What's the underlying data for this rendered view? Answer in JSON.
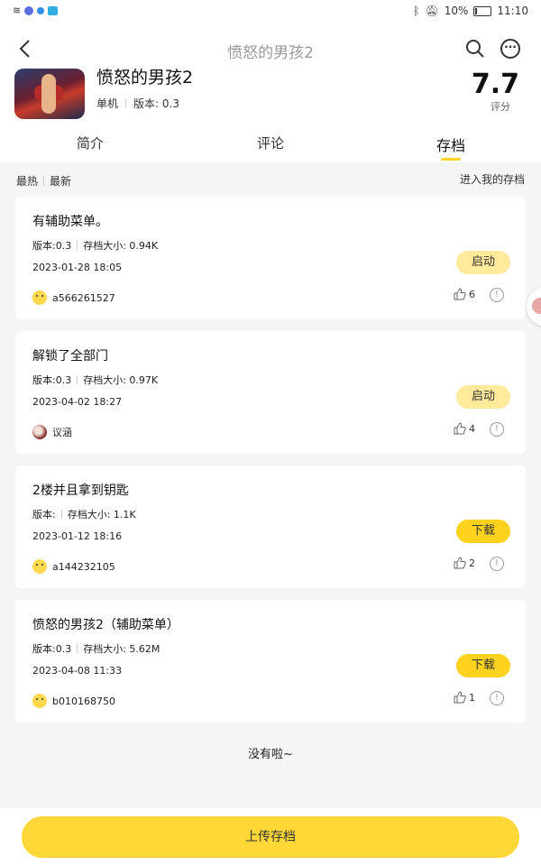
{
  "status_bar": {
    "battery": "10%",
    "time": "11:10"
  },
  "nav": {
    "title": "愤怒的男孩2"
  },
  "game": {
    "title": "愤怒的男孩2",
    "mode": "单机",
    "version": "版本: 0.3",
    "score": "7.7",
    "score_label": "评分"
  },
  "tabs": [
    {
      "label": "简介"
    },
    {
      "label": "评论"
    },
    {
      "label": "存档"
    }
  ],
  "filter": {
    "hot": "最热",
    "new": "最新",
    "my_saves": "进入我的存档"
  },
  "saves": [
    {
      "title": "有辅助菜单。",
      "version": "版本:0.3",
      "size": "存档大小: 0.94K",
      "date": "2023-01-28 18:05",
      "action": "启动",
      "user": "a566261527",
      "likes": "6"
    },
    {
      "title": "解锁了全部门",
      "version": "版本:0.3",
      "size": "存档大小: 0.97K",
      "date": "2023-04-02 18:27",
      "action": "启动",
      "user": "议涵",
      "likes": "4"
    },
    {
      "title": "2楼并且拿到钥匙",
      "version": "版本:",
      "size": "存档大小: 1.1K",
      "date": "2023-01-12 18:16",
      "action": "下载",
      "user": "a144232105",
      "likes": "2"
    },
    {
      "title": "愤怒的男孩2（辅助菜单）",
      "version": "版本:0.3",
      "size": "存档大小: 5.62M",
      "date": "2023-04-08 11:33",
      "action": "下载",
      "user": "b010168750",
      "likes": "1"
    }
  ],
  "end_text": "没有啦~",
  "upload_label": "上传存档",
  "colors": {
    "accent": "#ffd21e",
    "start_button": "#ffe99a"
  }
}
